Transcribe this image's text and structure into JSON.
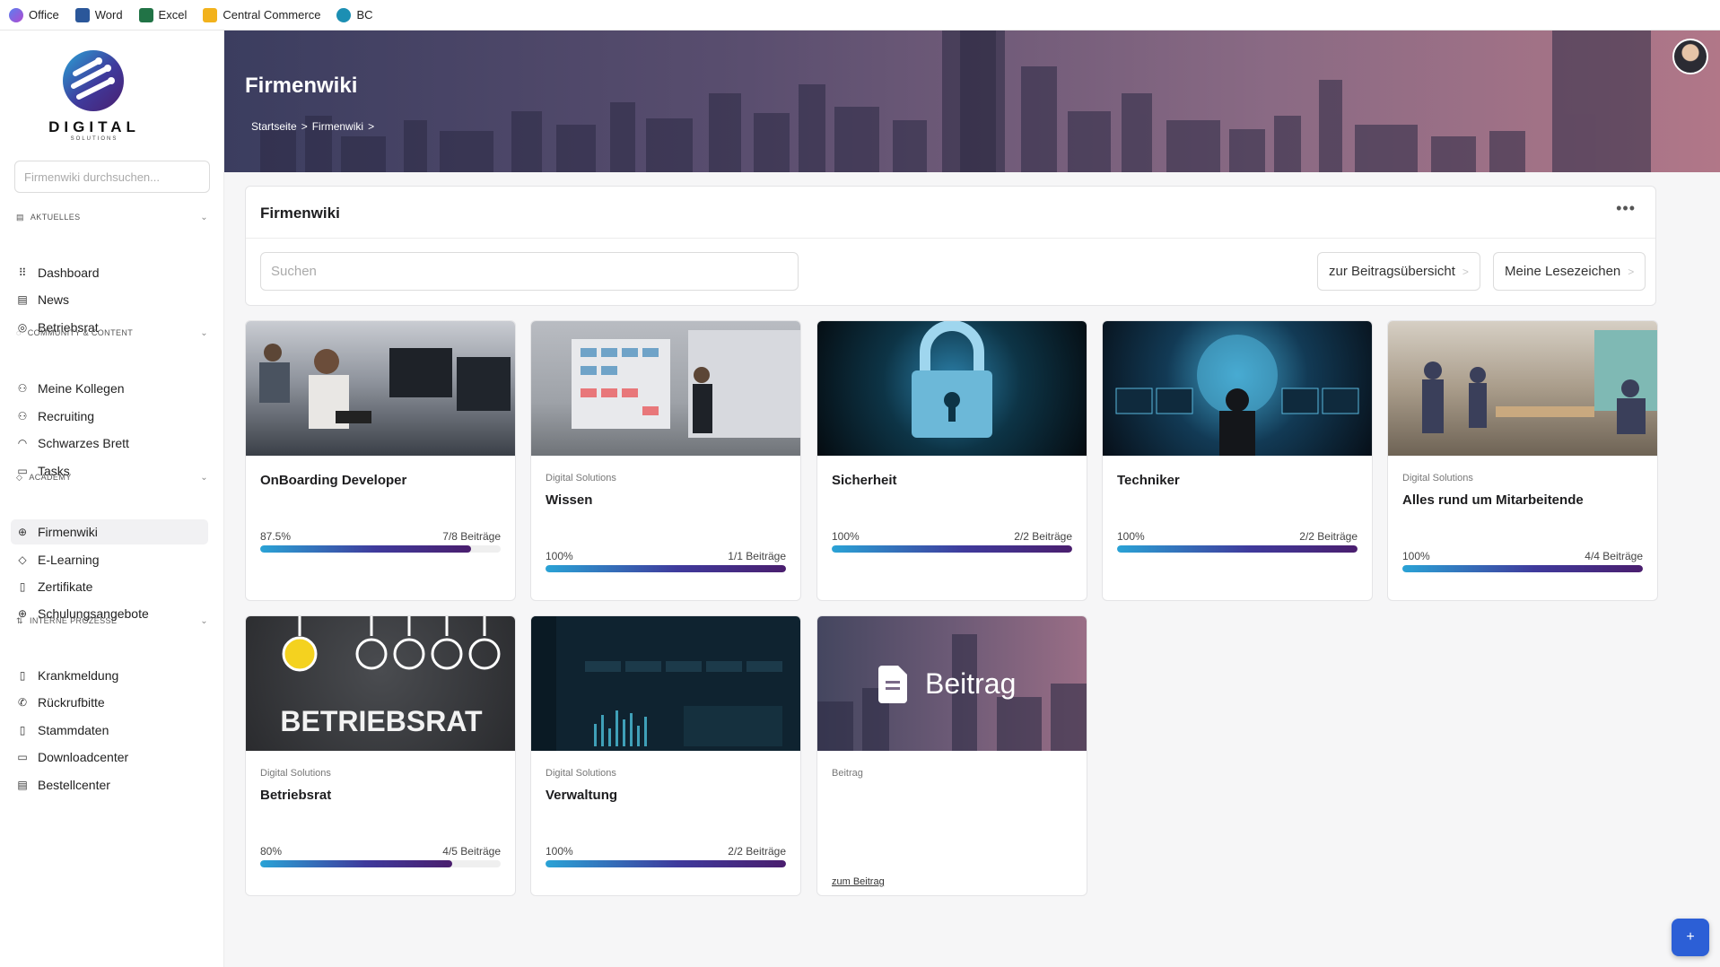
{
  "bookmarks": [
    {
      "label": "Office",
      "icon": "office-icon",
      "color": "#3c5bd6"
    },
    {
      "label": "Word",
      "icon": "word-icon",
      "color": "#2b579a"
    },
    {
      "label": "Excel",
      "icon": "excel-icon",
      "color": "#217346"
    },
    {
      "label": "Central Commerce",
      "icon": "folder-icon",
      "color": "#f2b21c"
    },
    {
      "label": "BC",
      "icon": "bc-icon",
      "color": "#1c8fb3"
    }
  ],
  "brand": {
    "word": "DIGITAL",
    "sub": "SOLUTIONS"
  },
  "sidebar": {
    "search_placeholder": "Firmenwiki durchsuchen...",
    "sections": [
      {
        "title": "AKTUELLES",
        "items": [
          "Dashboard",
          "News",
          "Betriebsrat"
        ]
      },
      {
        "title": "COMMUNITY & CONTENT",
        "items": [
          "Meine Kollegen",
          "Recruiting",
          "Schwarzes Brett",
          "Tasks"
        ]
      },
      {
        "title": "ACADEMY",
        "items": [
          "Firmenwiki",
          "E-Learning",
          "Zertifikate",
          "Schulungsangebote"
        ]
      },
      {
        "title": "INTERNE PROZESSE",
        "items": [
          "Krankmeldung",
          "Rückrufbitte",
          "Stammdaten",
          "Downloadcenter",
          "Bestellcenter"
        ]
      }
    ],
    "active": "Firmenwiki"
  },
  "hero": {
    "title": "Firmenwiki",
    "breadcrumb": [
      "Startseite",
      ">",
      "Firmenwiki",
      ">"
    ]
  },
  "panel": {
    "title": "Firmenwiki",
    "more": "•••",
    "search_placeholder": "Suchen",
    "btn_overview": "zur Beitragsübersicht",
    "btn_bookmarks": "Meine Lesezeichen",
    "btn_arrow": ">"
  },
  "cards": [
    {
      "org": "",
      "title": "OnBoarding Developer",
      "percent_label": "87.5%",
      "progress": 0.875,
      "count": "7/8 Beiträge",
      "image": "developers-office-photo"
    },
    {
      "org": "Digital Solutions",
      "title": "Wissen",
      "percent_label": "100%",
      "progress": 1.0,
      "count": "1/1 Beiträge",
      "image": "presentation-photo"
    },
    {
      "org": "",
      "title": "Sicherheit",
      "percent_label": "100%",
      "progress": 1.0,
      "count": "2/2 Beiträge",
      "image": "security-lock-photo"
    },
    {
      "org": "",
      "title": "Techniker",
      "percent_label": "100%",
      "progress": 1.0,
      "count": "2/2 Beiträge",
      "image": "control-room-photo"
    },
    {
      "org": "Digital Solutions",
      "title": "Alles rund um Mitarbeitende",
      "percent_label": "100%",
      "progress": 1.0,
      "count": "4/4 Beiträge",
      "image": "team-office-photo"
    },
    {
      "org": "Digital Solutions",
      "title": "Betriebsrat",
      "percent_label": "80%",
      "progress": 0.8,
      "count": "4/5 Beiträge",
      "image": "betriebsrat-bulbs-image",
      "image_text": "BETRIEBSRAT"
    },
    {
      "org": "Digital Solutions",
      "title": "Verwaltung",
      "percent_label": "100%",
      "progress": 1.0,
      "count": "2/2 Beiträge",
      "image": "dashboard-screenshot"
    },
    {
      "org": "Beitrag",
      "title": "",
      "link": "zum Beitrag",
      "image": "beitrag-placeholder",
      "image_text": "Beitrag"
    }
  ],
  "fab": {
    "label": "+"
  }
}
